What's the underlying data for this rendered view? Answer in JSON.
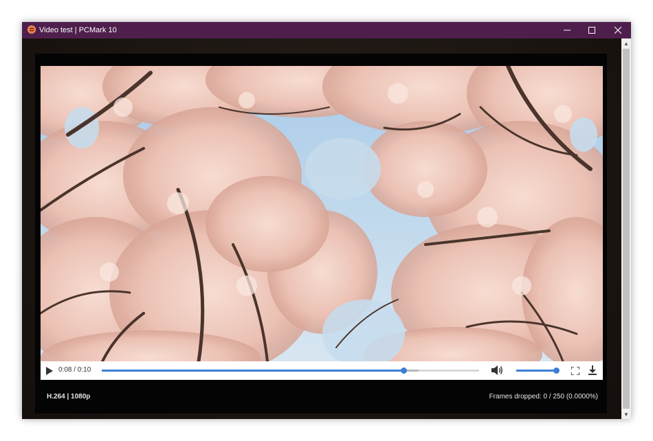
{
  "window": {
    "title": "Video test | PCMark 10",
    "accent_color": "#4e1f4c",
    "controls": [
      "minimize-icon",
      "maximize-icon",
      "close-icon"
    ]
  },
  "video": {
    "description_icon": "video-frame",
    "progress_fraction": 0.8,
    "buffered_fraction": 0.84,
    "volume_fraction": 1.0
  },
  "player": {
    "time_display": "0:08 / 0:10",
    "accent_color": "#3b7ed6",
    "icons": [
      "play-icon",
      "volume-icon",
      "fullscreen-icon",
      "download-icon"
    ]
  },
  "info": {
    "codec_resolution": "H.264 | 1080p",
    "frames_dropped": "Frames dropped: 0 / 250 (0.0000%)"
  }
}
